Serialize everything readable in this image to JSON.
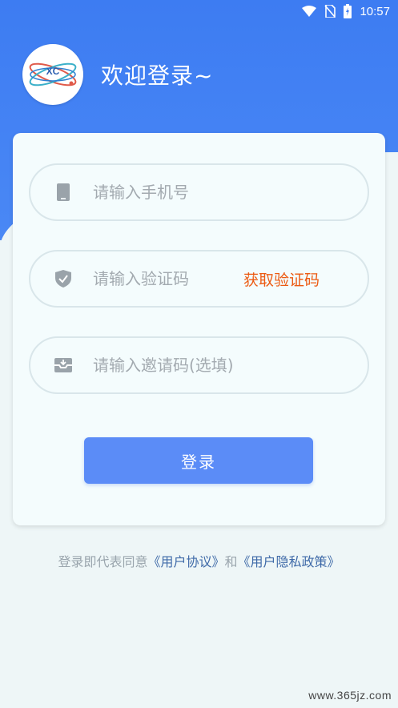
{
  "status_bar": {
    "time": "10:57"
  },
  "header": {
    "welcome": "欢迎登录~",
    "logo_icon": "atom-logo"
  },
  "form": {
    "phone_placeholder": "请输入手机号",
    "code_placeholder": "请输入验证码",
    "get_code_label": "获取验证码",
    "invite_placeholder": "请输入邀请码(选填)",
    "login_label": "登录"
  },
  "agreement": {
    "prefix": "登录即代表同意",
    "user_agreement": "《用户协议》",
    "and": "和",
    "privacy_policy": "《用户隐私政策》"
  },
  "watermark": "www.365jz.com",
  "colors": {
    "primary": "#3d7cf2",
    "button": "#5b8cf7",
    "accent": "#ec5a12",
    "link": "#3f6aa8"
  }
}
